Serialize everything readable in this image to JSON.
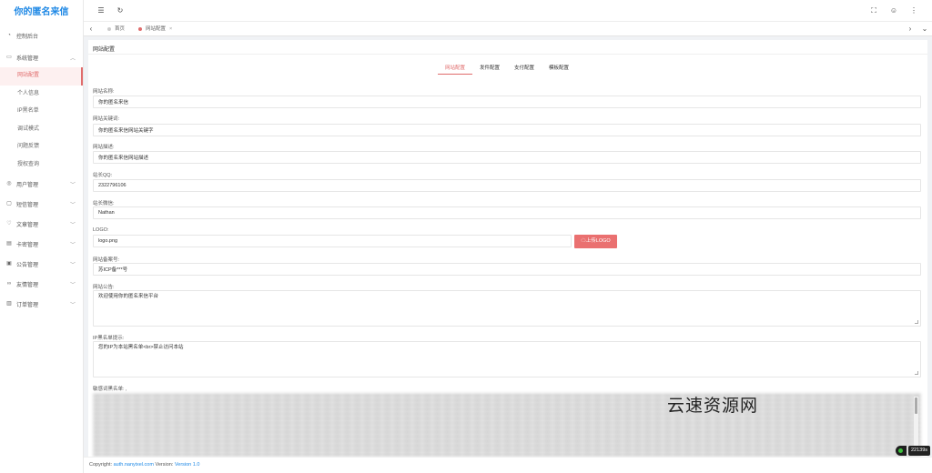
{
  "app": {
    "title": "你的匿名来信"
  },
  "colors": {
    "accent": "#e06c6c",
    "brand": "#1e88e5",
    "upload": "#ea7070"
  },
  "sidebar": {
    "dashboard": {
      "label": "控制后台",
      "icon": "dashboard-icon"
    },
    "system": {
      "label": "系统管理",
      "icon": "monitor-icon",
      "items": [
        {
          "label": "网站配置"
        },
        {
          "label": "个人信息"
        },
        {
          "label": "IP黑名单"
        },
        {
          "label": "调试模式"
        },
        {
          "label": "问题反馈"
        },
        {
          "label": "授权查询"
        }
      ]
    },
    "menus": [
      {
        "label": "用户管理",
        "icon": "user-icon"
      },
      {
        "label": "短信管理",
        "icon": "message-icon"
      },
      {
        "label": "文章管理",
        "icon": "shield-icon"
      },
      {
        "label": "卡密管理",
        "icon": "card-icon"
      },
      {
        "label": "公告管理",
        "icon": "notice-icon"
      },
      {
        "label": "友情管理",
        "icon": "link-icon"
      },
      {
        "label": "订单管理",
        "icon": "order-icon"
      }
    ]
  },
  "header": {
    "menu_icon": "☰",
    "refresh_icon": "↻",
    "fullscreen_icon": "⛶",
    "user_icon": "☺",
    "more_icon": "⋮"
  },
  "tabs": {
    "prev_icon": "‹",
    "next_icon": "›",
    "down_icon": "⌄",
    "items": [
      {
        "label": "首页"
      },
      {
        "label": "网站配置",
        "close": "×"
      }
    ]
  },
  "card": {
    "title": "网站配置",
    "tabs": [
      "网站配置",
      "发件配置",
      "支付配置",
      "模板配置"
    ],
    "fields": {
      "site_name": {
        "label": "网站名称:",
        "value": "你的匿名来信"
      },
      "keywords": {
        "label": "网站关键词:",
        "value": "你的匿名来信网站关键字"
      },
      "description": {
        "label": "网站描述:",
        "value": "你的匿名来信网站描述"
      },
      "qq": {
        "label": "站长QQ:",
        "value": "2322796106"
      },
      "wechat": {
        "label": "站长微信:",
        "value": "Nathan"
      },
      "logo": {
        "label": "LOGO:",
        "value": "logo.png",
        "button": "☁上传LOGO"
      },
      "icp": {
        "label": "网站备案号:",
        "value": "苏ICP备***号"
      },
      "notice": {
        "label": "网站公告:",
        "value": "欢迎使用你的匿名来信平台"
      },
      "ip_tip": {
        "label": "IP黑名单提示:",
        "value": "您的IP为本站黑名单<br>禁止访问本站"
      },
      "sensitive": {
        "label": "敏感词黑名单: ,"
      }
    }
  },
  "footer": {
    "copyright_label": "Copyright:",
    "copyright_link": "auth.nanyixel.com",
    "version_label": "Version:",
    "version_value": "Version 1.0"
  },
  "watermark": "云速资源网",
  "badge": "22139s"
}
